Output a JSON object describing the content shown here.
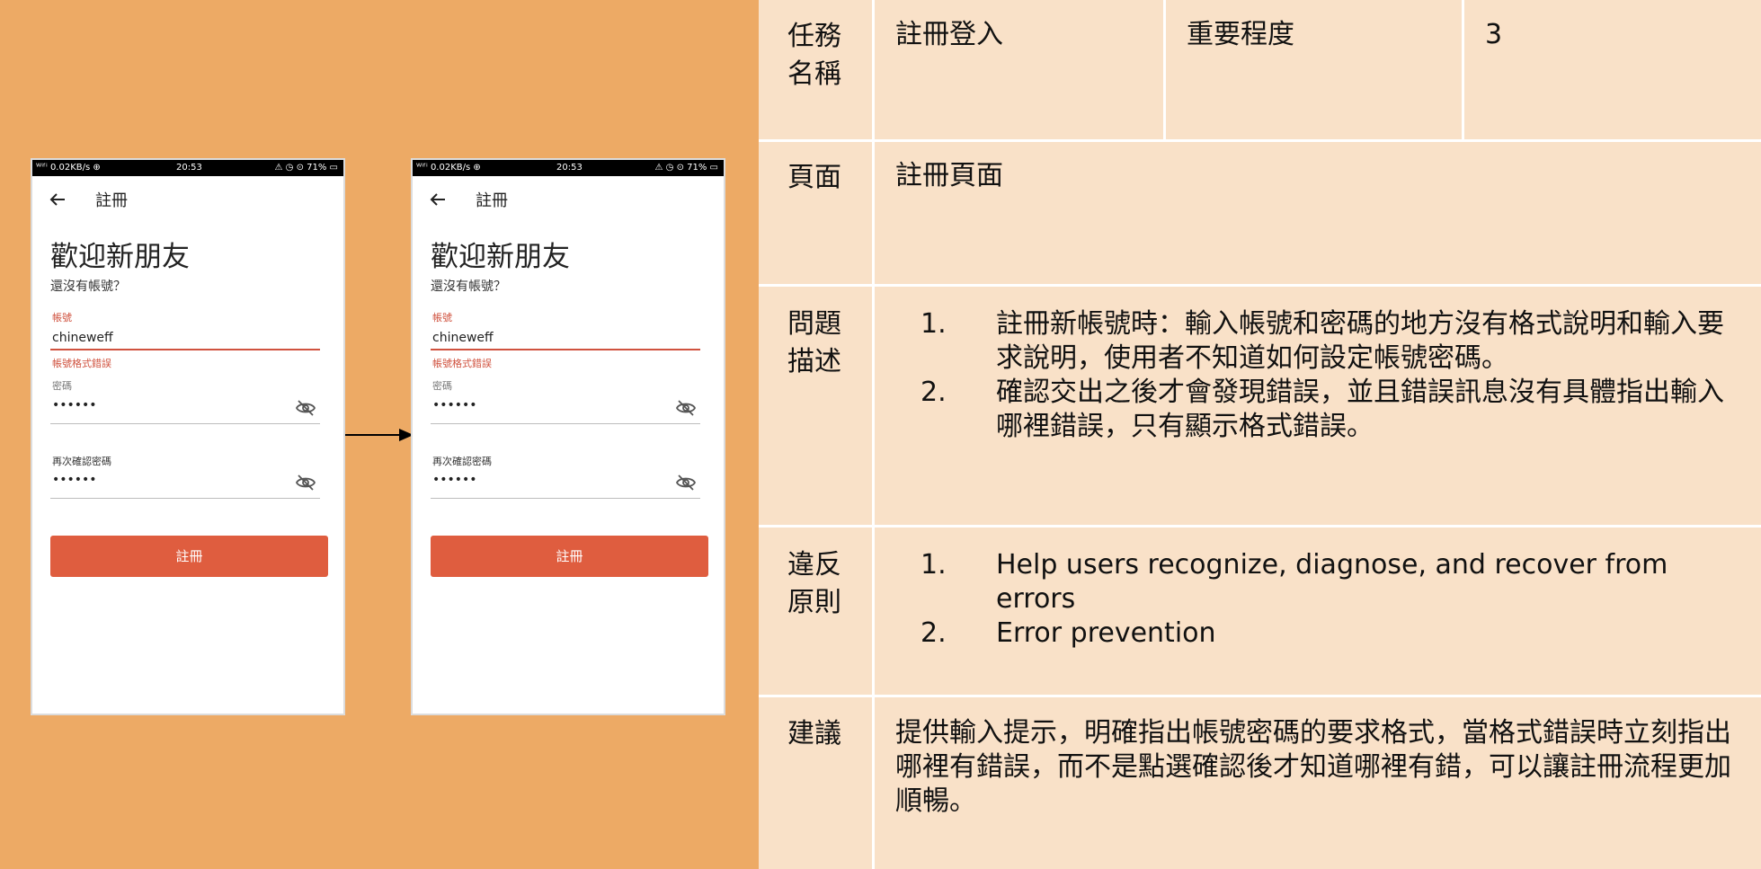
{
  "phones": [
    {
      "status": {
        "left": "ᵂⁱᶠⁱ 0.02KB/s ⊕",
        "time": "20:53",
        "right": "⚠ ◷ ⊙ 71% ▭"
      },
      "app_title": "註冊",
      "welcome": "歡迎新朋友",
      "subtitle": "還沒有帳號？",
      "account_label": "帳號",
      "account_value": "chineweff",
      "account_error": "帳號格式錯誤",
      "password_label": "密碼",
      "password_value": "••••••",
      "confirm_label": "再次確認密碼",
      "confirm_value": "••••••",
      "button_label": "註冊"
    },
    {
      "status": {
        "left": "ᵂⁱᶠⁱ 0.02KB/s ⊕",
        "time": "20:53",
        "right": "⚠ ◷ ⊙ 71% ▭"
      },
      "app_title": "註冊",
      "welcome": "歡迎新朋友",
      "subtitle": "還沒有帳號？",
      "account_label": "帳號",
      "account_value": "chineweff",
      "account_error": "帳號格式錯誤",
      "password_label": "密碼",
      "password_value": "••••••",
      "confirm_label": "再次確認密碼",
      "confirm_value": "••••••",
      "button_label": "註冊"
    }
  ],
  "table": {
    "task_header": "任務\n名稱",
    "task_value": "註冊登入",
    "importance_header": "重要程度",
    "importance_value": "3",
    "page_header": "頁面",
    "page_value": "註冊頁面",
    "problem_header": "問題\n描述",
    "problems": [
      {
        "num": "1.",
        "text": "註冊新帳號時：輸入帳號和密碼的地方沒有格式說明和輸入要求說明，使用者不知道如何設定帳號密碼。"
      },
      {
        "num": "2.",
        "text": "確認交出之後才會發現錯誤，並且錯誤訊息沒有具體指出輸入哪裡錯誤，只有顯示格式錯誤。"
      }
    ],
    "violation_header": "違反\n原則",
    "violations": [
      {
        "num": "1.",
        "text": "Help users recognize, diagnose, and recover from errors"
      },
      {
        "num": "2.",
        "text": "Error prevention"
      }
    ],
    "suggestion_header": "建議",
    "suggestion_value": "提供輸入提示，明確指出帳號密碼的要求格式，當格式錯誤時立刻指出哪裡有錯誤，而不是點選確認後才知道哪裡有錯，可以讓註冊流程更加順暢。"
  },
  "colors": {
    "background": "#EDAA65",
    "table": "#F9E1C8",
    "button": "#DF5D3F",
    "error": "#D0523F"
  }
}
